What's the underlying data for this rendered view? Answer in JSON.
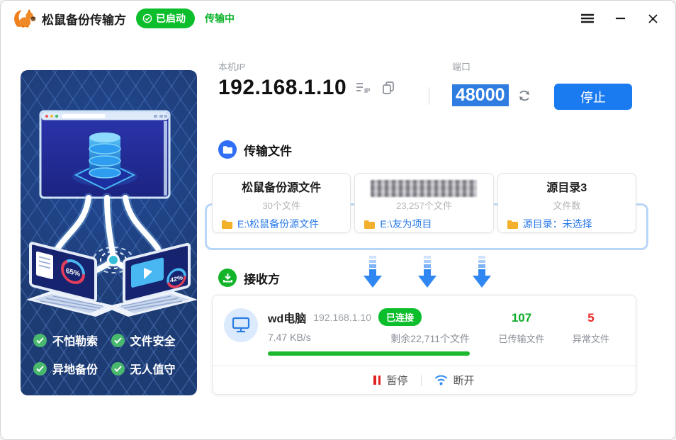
{
  "titlebar": {
    "title": "松鼠备份传输方",
    "status_badge": "已启动",
    "status_text": "传输中"
  },
  "network": {
    "ip_label": "本机IP",
    "ip": "192.168.1.10",
    "port_label": "端口",
    "port": "48000",
    "stop_button": "停止"
  },
  "transfer": {
    "section_title": "传输文件",
    "cards": [
      {
        "name": "松鼠备份源文件",
        "count": "30个文件",
        "path": "E:\\松鼠备份源文件"
      },
      {
        "name": "",
        "count": "23,257个文件",
        "path": "E:\\友为项目"
      },
      {
        "name": "源目录3",
        "count": "文件数",
        "path": "源目录：未选择"
      }
    ]
  },
  "receiver": {
    "section_title": "接收方",
    "device_name": "wd电脑",
    "device_ip": "192.168.1.10",
    "connection_badge": "已连接",
    "speed": "7.47 KB/s",
    "remaining": "剩余22,711个文件",
    "transferred_count": "107",
    "transferred_label": "已传输文件",
    "error_count": "5",
    "error_label": "异常文件",
    "pause_label": "暂停",
    "disconnect_label": "断开"
  },
  "panel": {
    "features": [
      "不怕勒索",
      "文件安全",
      "异地备份",
      "无人值守"
    ],
    "left_laptop_progress": "65%",
    "right_laptop_progress": "42%"
  },
  "colors": {
    "accent_blue": "#1a7af0",
    "link_blue": "#2779e8",
    "success_green": "#0cbe2c",
    "error_red": "#f02222",
    "panel_navy": "#1e3c74"
  }
}
